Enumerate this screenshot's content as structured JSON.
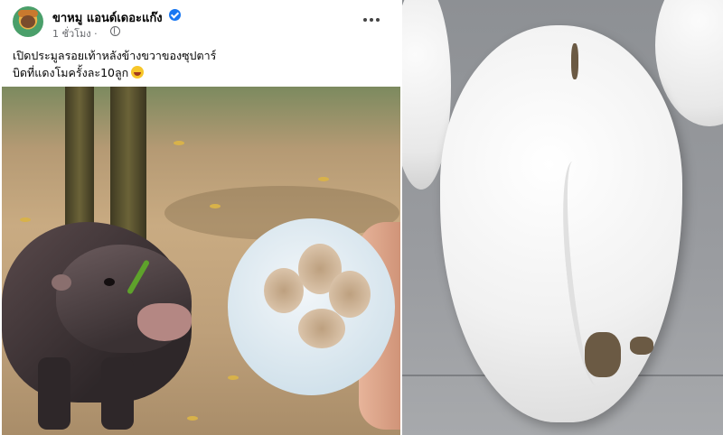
{
  "post": {
    "page_name": "ขาหมู แอนด์เดอะแก๊ง",
    "time": "1 ชั่วโมง ·",
    "caption_lines": [
      "เปิดประมูลรอยเท้าหลังข้างขวาของซุปตาร์",
      "บิดที่แดงโมครั้งละ10ลูก"
    ]
  },
  "icons": {
    "verified": "verified-badge-icon",
    "privacy": "globe-icon",
    "menu": "more-options-icon",
    "emoji": "laughing-face-emoji-icon"
  },
  "colors": {
    "verified_blue": "#1877f2",
    "meta_gray": "#65676b",
    "text_dark": "#050505"
  }
}
